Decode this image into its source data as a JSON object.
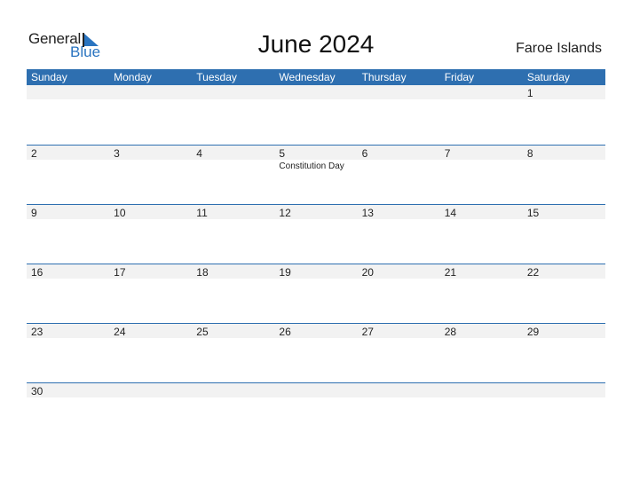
{
  "logo": {
    "word1": "General",
    "word2": "Blue"
  },
  "title": "June 2024",
  "country": "Faroe Islands",
  "colors": {
    "accent": "#2e6fb0",
    "band": "#f2f2f2"
  },
  "weekdays": [
    "Sunday",
    "Monday",
    "Tuesday",
    "Wednesday",
    "Thursday",
    "Friday",
    "Saturday"
  ],
  "weeks": [
    {
      "days": [
        "",
        "",
        "",
        "",
        "",
        "",
        "1"
      ],
      "holidays": [
        "",
        "",
        "",
        "",
        "",
        "",
        ""
      ]
    },
    {
      "days": [
        "2",
        "3",
        "4",
        "5",
        "6",
        "7",
        "8"
      ],
      "holidays": [
        "",
        "",
        "",
        "Constitution Day",
        "",
        "",
        ""
      ]
    },
    {
      "days": [
        "9",
        "10",
        "11",
        "12",
        "13",
        "14",
        "15"
      ],
      "holidays": [
        "",
        "",
        "",
        "",
        "",
        "",
        ""
      ]
    },
    {
      "days": [
        "16",
        "17",
        "18",
        "19",
        "20",
        "21",
        "22"
      ],
      "holidays": [
        "",
        "",
        "",
        "",
        "",
        "",
        ""
      ]
    },
    {
      "days": [
        "23",
        "24",
        "25",
        "26",
        "27",
        "28",
        "29"
      ],
      "holidays": [
        "",
        "",
        "",
        "",
        "",
        "",
        ""
      ]
    },
    {
      "days": [
        "30",
        "",
        "",
        "",
        "",
        "",
        ""
      ],
      "holidays": [
        "",
        "",
        "",
        "",
        "",
        "",
        ""
      ]
    }
  ]
}
